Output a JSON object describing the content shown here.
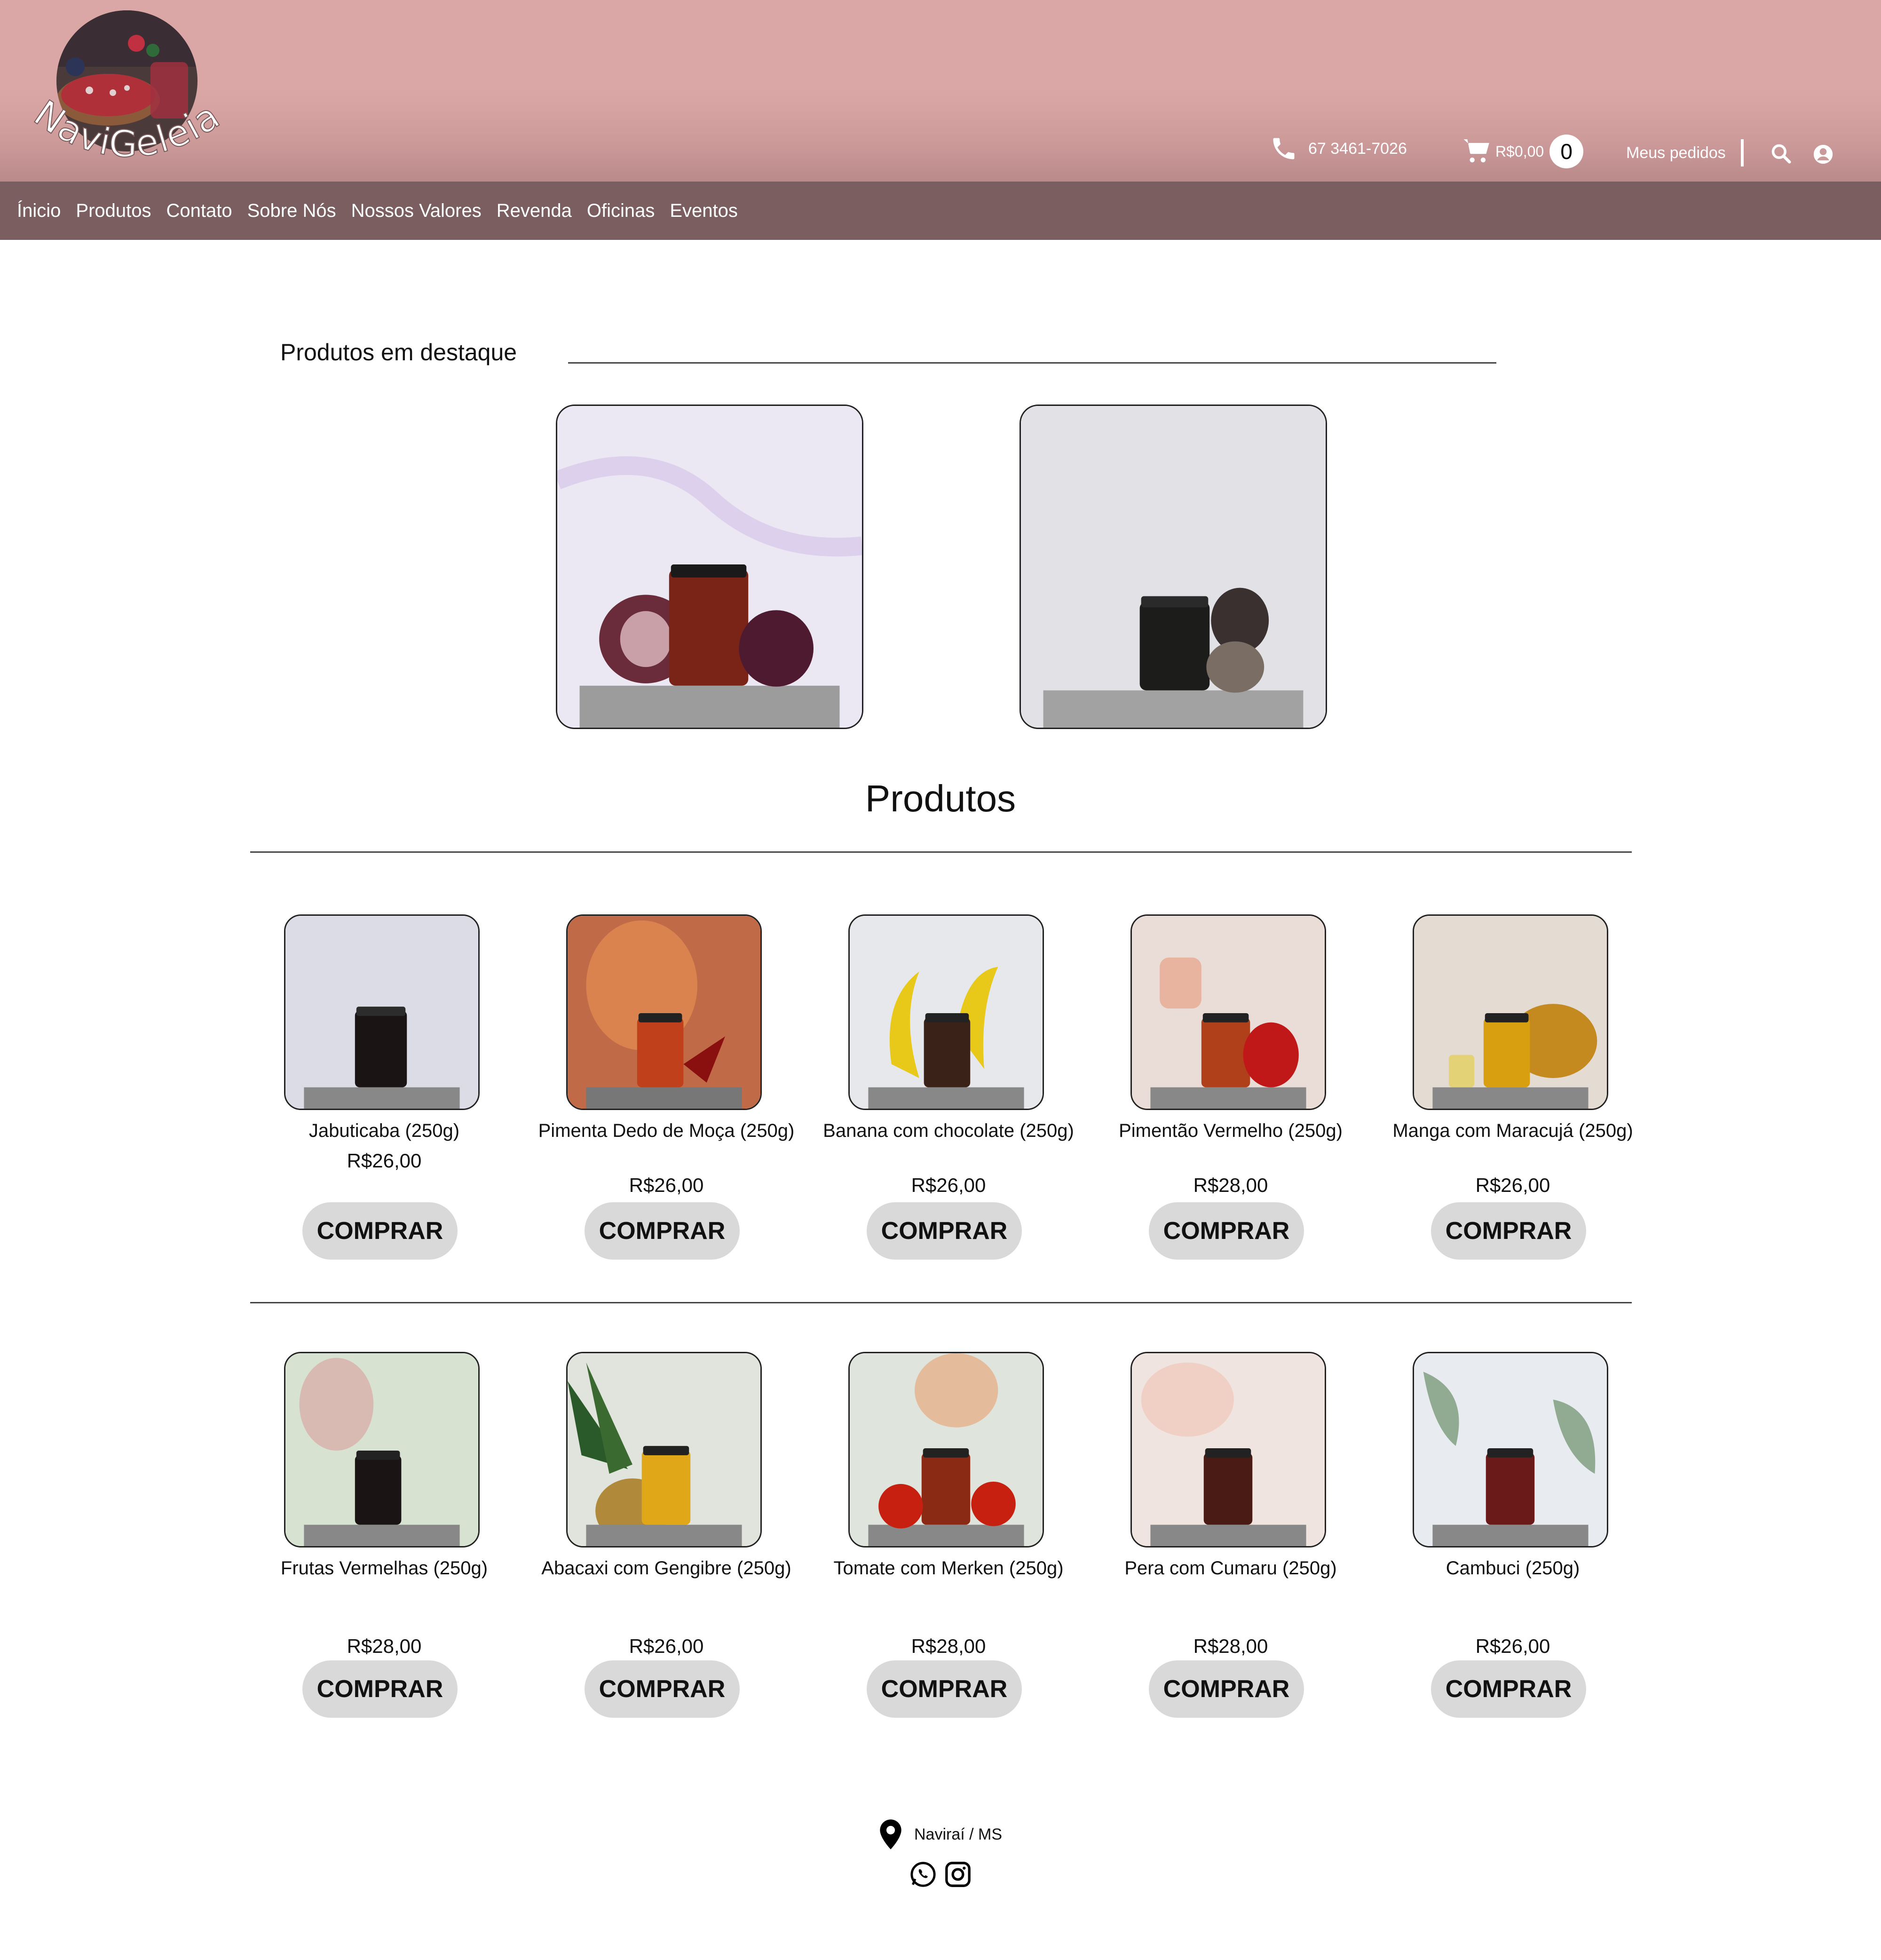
{
  "header": {
    "logo_text": "NaviGeleias",
    "phone": "67 3461-7026",
    "cart_total": "R$0,00",
    "cart_count": "0",
    "orders_label": "Meus pedidos"
  },
  "nav": {
    "items": [
      "Ínicio",
      "Produtos",
      "Contato",
      "Sobre Nós",
      "Nossos Valores",
      "Revenda",
      "Oficinas",
      "Eventos"
    ]
  },
  "featured": {
    "title": "Produtos em destaque"
  },
  "products_title": "Produtos",
  "buy_label": "COMPRAR",
  "products": [
    {
      "name": "Jabuticaba (250g)",
      "price": "R$26,00"
    },
    {
      "name": "Pimenta Dedo de Moça (250g)",
      "price": "R$26,00"
    },
    {
      "name": "Banana com chocolate (250g)",
      "price": "R$26,00"
    },
    {
      "name": "Pimentão Vermelho (250g)",
      "price": "R$28,00"
    },
    {
      "name": "Manga com Maracujá (250g)",
      "price": "R$26,00"
    },
    {
      "name": "Frutas Vermelhas (250g)",
      "price": "R$28,00"
    },
    {
      "name": "Abacaxi com Gengibre (250g)",
      "price": "R$26,00"
    },
    {
      "name": "Tomate com Merken (250g)",
      "price": "R$28,00"
    },
    {
      "name": "Pera com Cumaru (250g)",
      "price": "R$28,00"
    },
    {
      "name": "Cambuci (250g)",
      "price": "R$26,00"
    }
  ],
  "footer": {
    "location": "Naviraí / MS"
  },
  "colors": {
    "header_pink": "#dba6a6",
    "nav_brown": "#7b5e60",
    "button_gray": "#d9d9d9"
  }
}
